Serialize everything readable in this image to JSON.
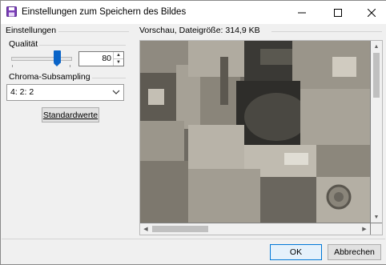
{
  "window": {
    "title": "Einstellungen zum Speichern des Bildes",
    "icon": "floppy-disk-icon",
    "controls": [
      "minimize-icon",
      "maximize-icon",
      "close-icon"
    ]
  },
  "settings": {
    "section_label": "Einstellungen",
    "quality_label": "Qualität",
    "quality_value": "80",
    "quality_slider_level": 0.8,
    "chroma_label": "Chroma-Subsampling",
    "chroma_selected": "4: 2: 2",
    "defaults_button": "Standardwerte"
  },
  "preview": {
    "label": "Vorschau, Dateigröße: 314,9 KB"
  },
  "footer": {
    "ok_label": "OK",
    "cancel_label": "Abbrechen"
  },
  "colors": {
    "accent": "#0a64c8",
    "ok_border": "#0078d7"
  }
}
